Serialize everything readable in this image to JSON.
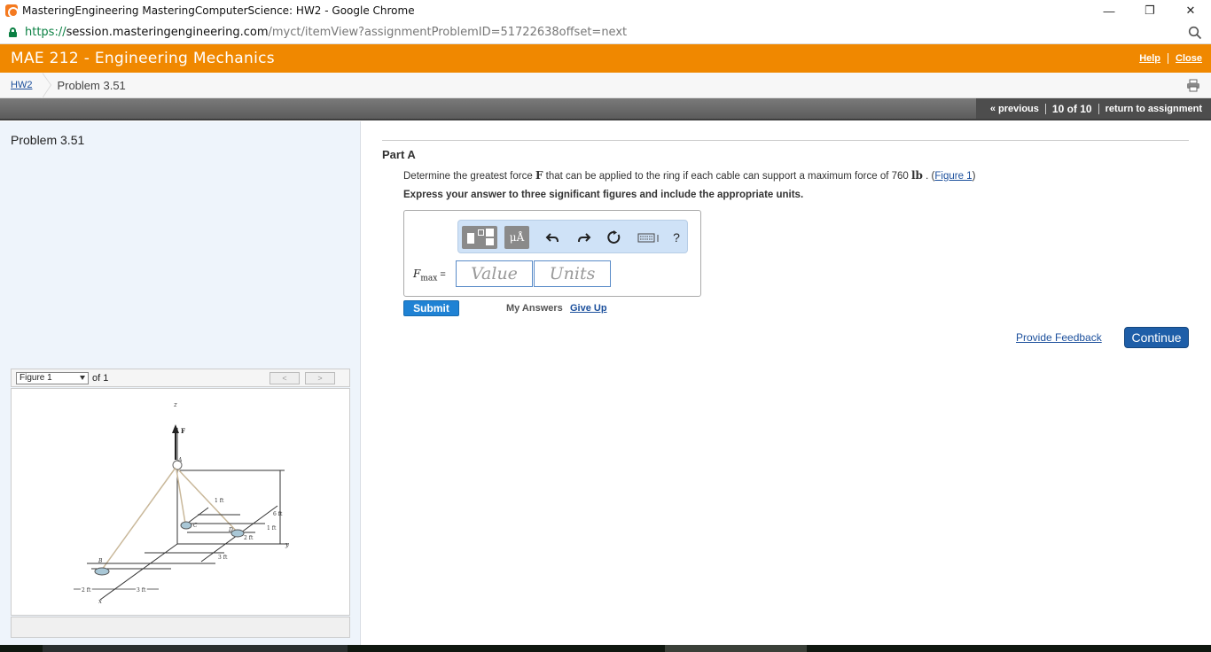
{
  "browser": {
    "window_title": "MasteringEngineering MasteringComputerScience: HW2 - Google Chrome",
    "minimize": "—",
    "restore": "❐",
    "close": "✕",
    "url_scheme": "https://",
    "url_host": "session.masteringengineering.com",
    "url_path": "/myct/itemView?assignmentProblemID=51722638offset=next"
  },
  "header": {
    "course_title": "MAE 212 - Engineering Mechanics",
    "help_link": "Help",
    "close_link": "Close"
  },
  "breadcrumb": {
    "parent": "HW2",
    "current": "Problem 3.51"
  },
  "nav": {
    "previous": "« previous",
    "position": "10 of 10",
    "return": "return to assignment"
  },
  "left": {
    "problem_title": "Problem 3.51",
    "figure_select": "Figure 1",
    "figure_of": "of 1",
    "prev_btn": "<",
    "next_btn": ">"
  },
  "figure": {
    "z": "z",
    "F": "F",
    "A": "A",
    "B": "B",
    "C": "C",
    "D": "D",
    "x": "x",
    "y": "y",
    "d1ft": "1 ft",
    "d6ft": "6 ft",
    "d1ft_b": "1 ft",
    "d2ft": "2 ft",
    "d3ft": "3 ft",
    "d2ft_b": "2 ft",
    "d3ft_b": "3 ft"
  },
  "part": {
    "title": "Part A",
    "q_before": "Determine the greatest force ",
    "q_symbol": "F",
    "q_middle": " that can be applied to the ring if each cable can support a maximum force of 760 ",
    "q_unit": "lb",
    "q_after": " . (",
    "q_link": "Figure 1",
    "q_close": ")",
    "instruction": "Express your answer to three significant figures and include the appropriate units."
  },
  "answer": {
    "units_btn": "μÅ",
    "help_icon": "?",
    "label_var": "F",
    "label_sub": "max",
    "label_eq": " =",
    "value_placeholder": "Value",
    "units_placeholder": "Units",
    "submit": "Submit",
    "my_answers": "My Answers",
    "give_up": "Give Up"
  },
  "footer": {
    "feedback": "Provide Feedback",
    "continue": "Continue"
  }
}
